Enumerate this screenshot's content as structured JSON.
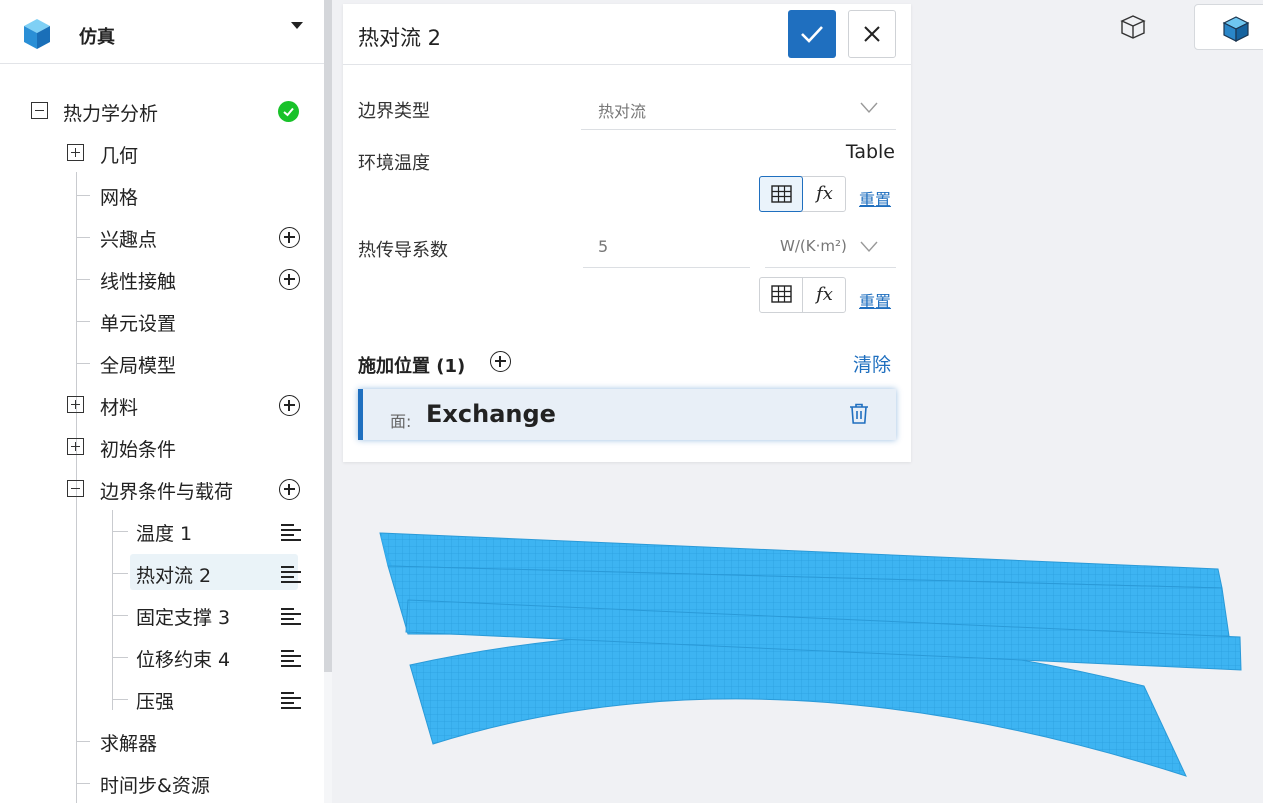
{
  "app": {
    "title": "仿真"
  },
  "tree": {
    "root": {
      "label": "热力学分析"
    },
    "items": {
      "geometry": "几何",
      "mesh": "网格",
      "poi": "兴趣点",
      "linear_contact": "线性接触",
      "element_settings": "单元设置",
      "global_model": "全局模型",
      "material": "材料",
      "initial_conditions": "初始条件",
      "boundary_loads": "边界条件与载荷",
      "temperature_1": "温度 1",
      "heat_convection_2": "热对流 2",
      "fixed_support_3": "固定支撑 3",
      "displacement_constraint_4": "位移约束 4",
      "pressure": "压强",
      "solver": "求解器",
      "time_steps": "时间步&资源"
    }
  },
  "panel": {
    "title": "热对流 2",
    "boundary_type": {
      "label": "边界类型",
      "value": "热对流"
    },
    "ambient_temperature": {
      "label": "环境温度",
      "value": "Table",
      "reset": "重置",
      "fx": "fx"
    },
    "heat_transfer_coefficient": {
      "label": "热传导系数",
      "value": "5",
      "unit": "W/(K·m²)",
      "reset": "重置",
      "fx": "fx"
    },
    "location": {
      "label": "施加位置 (1)",
      "clear": "清除",
      "face_prefix": "面:",
      "face_name": "Exchange"
    }
  },
  "colors": {
    "accent": "#1f6fbf",
    "mesh": "#3db4f2",
    "ok": "#19c22a"
  }
}
